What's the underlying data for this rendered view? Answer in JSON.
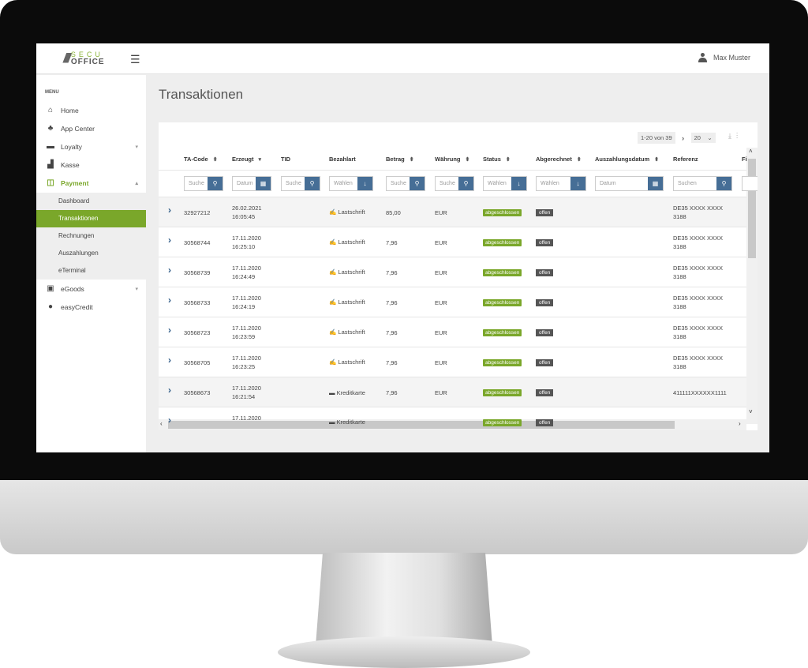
{
  "header": {
    "logo_top": "SECU",
    "logo_bottom": "OFFICE",
    "user_name": "Max Muster"
  },
  "sidebar": {
    "menu_label": "MENU",
    "items": [
      {
        "label": "Home",
        "icon": "home-icon",
        "glyph": "⌂"
      },
      {
        "label": "App Center",
        "icon": "apps-icon",
        "glyph": "♣"
      },
      {
        "label": "Loyalty",
        "icon": "card-icon",
        "glyph": "▬",
        "caret": "▾"
      },
      {
        "label": "Kasse",
        "icon": "register-icon",
        "glyph": "▟"
      },
      {
        "label": "Payment",
        "icon": "payment-icon",
        "glyph": "◫",
        "caret": "▴",
        "active": true
      },
      {
        "label": "eGoods",
        "icon": "egoods-icon",
        "glyph": "▣",
        "caret": "▾"
      },
      {
        "label": "easyCredit",
        "icon": "credit-icon",
        "glyph": "●"
      }
    ],
    "subitems": [
      "Dashboard",
      "Transaktionen",
      "Rechnungen",
      "Auszahlungen",
      "eTerminal"
    ],
    "selected_sub": 1
  },
  "page": {
    "title": "Transaktionen"
  },
  "pagination": {
    "range": "1-20 von 39",
    "next": "›",
    "page_size": "20"
  },
  "table": {
    "columns": [
      {
        "label": "TA-Code",
        "sort": "⬍",
        "filter": "Suche",
        "btn": "⚲"
      },
      {
        "label": "Erzeugt",
        "sort": "▾",
        "filter": "Datum",
        "btn": "▦"
      },
      {
        "label": "TID",
        "sort": "",
        "filter": "Suche",
        "btn": "⚲"
      },
      {
        "label": "Bezahlart",
        "sort": "",
        "filter": "Wählen",
        "btn": "↓"
      },
      {
        "label": "Betrag",
        "sort": "⬍",
        "filter": "Suche",
        "btn": "⚲"
      },
      {
        "label": "Währung",
        "sort": "⬍",
        "filter": "Suche",
        "btn": "⚲"
      },
      {
        "label": "Status",
        "sort": "⬍",
        "filter": "Wählen",
        "btn": "↓"
      },
      {
        "label": "Abgerechnet",
        "sort": "⬍",
        "filter": "Wählen",
        "btn": "↓"
      },
      {
        "label": "Auszahlungsdatum",
        "sort": "⬍",
        "filter": "Datum",
        "btn": "▦"
      },
      {
        "label": "Referenz",
        "sort": "",
        "filter": "Suchen",
        "btn": "⚲"
      },
      {
        "label": "Fi",
        "sort": "",
        "filter": "",
        "btn": ""
      }
    ],
    "rows": [
      {
        "code": "32927212",
        "date": "26.02.2021",
        "time": "16:05:45",
        "method": "Lastschrift",
        "amount": "85,00",
        "currency": "EUR",
        "status": "abgeschlossen",
        "settled": "offen",
        "ref1": "DE35 XXXX XXXX",
        "ref2": "3188"
      },
      {
        "code": "30568744",
        "date": "17.11.2020",
        "time": "16:25:10",
        "method": "Lastschrift",
        "amount": "7,96",
        "currency": "EUR",
        "status": "abgeschlossen",
        "settled": "offen",
        "ref1": "DE35 XXXX XXXX",
        "ref2": "3188"
      },
      {
        "code": "30568739",
        "date": "17.11.2020",
        "time": "16:24:49",
        "method": "Lastschrift",
        "amount": "7,96",
        "currency": "EUR",
        "status": "abgeschlossen",
        "settled": "offen",
        "ref1": "DE35 XXXX XXXX",
        "ref2": "3188"
      },
      {
        "code": "30568733",
        "date": "17.11.2020",
        "time": "16:24:19",
        "method": "Lastschrift",
        "amount": "7,96",
        "currency": "EUR",
        "status": "abgeschlossen",
        "settled": "offen",
        "ref1": "DE35 XXXX XXXX",
        "ref2": "3188"
      },
      {
        "code": "30568723",
        "date": "17.11.2020",
        "time": "16:23:59",
        "method": "Lastschrift",
        "amount": "7,96",
        "currency": "EUR",
        "status": "abgeschlossen",
        "settled": "offen",
        "ref1": "DE35 XXXX XXXX",
        "ref2": "3188"
      },
      {
        "code": "30568705",
        "date": "17.11.2020",
        "time": "16:23:25",
        "method": "Lastschrift",
        "amount": "7,96",
        "currency": "EUR",
        "status": "abgeschlossen",
        "settled": "offen",
        "ref1": "DE35 XXXX XXXX",
        "ref2": "3188"
      },
      {
        "code": "30568673",
        "date": "17.11.2020",
        "time": "16:21:54",
        "method": "Kreditkarte",
        "amount": "7,96",
        "currency": "EUR",
        "status": "abgeschlossen",
        "settled": "offen",
        "ref1": "411111XXXXXX1111",
        "ref2": ""
      },
      {
        "code": "",
        "date": "17.11.2020",
        "time": "",
        "method": "Kreditkarte",
        "amount": "",
        "currency": "",
        "status": "abgeschlossen",
        "settled": "offen",
        "ref1": "",
        "ref2": ""
      }
    ]
  },
  "colors": {
    "accent": "#7aa72a",
    "button": "#466e96",
    "badge_offen": "#555555"
  }
}
